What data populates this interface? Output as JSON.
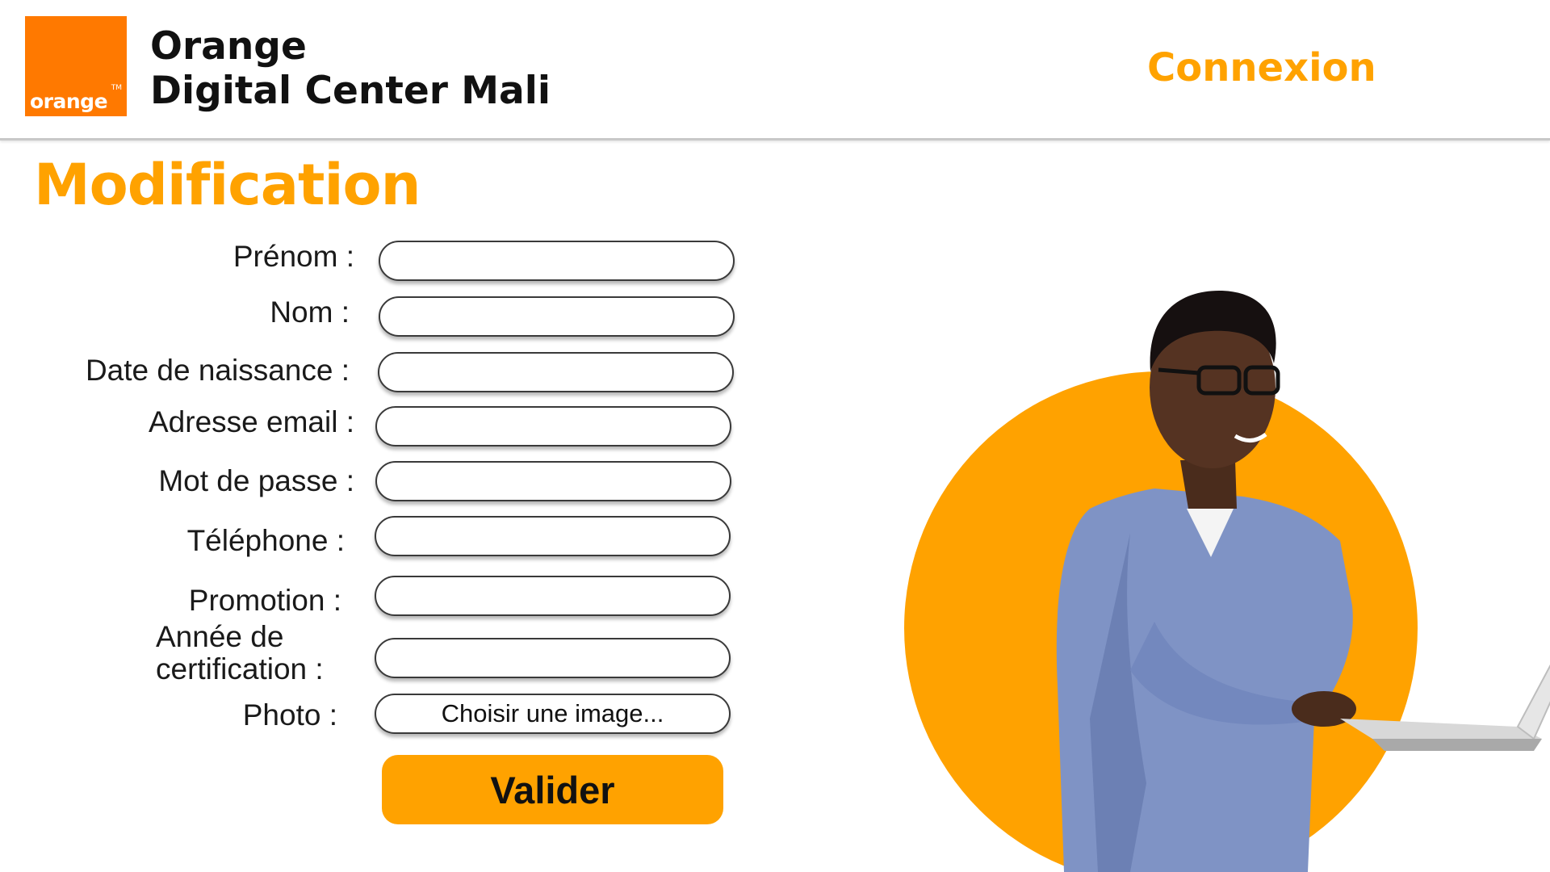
{
  "header": {
    "logo_text": "orange",
    "logo_tm": "TM",
    "brand_line1": "Orange",
    "brand_line2": "Digital Center Mali",
    "login_link": "Connexion"
  },
  "page": {
    "title": "Modification"
  },
  "form": {
    "fields": [
      {
        "label": "Prénom :",
        "value": ""
      },
      {
        "label": "Nom :",
        "value": ""
      },
      {
        "label": "Date de naissance :",
        "value": ""
      },
      {
        "label": "Adresse email :",
        "value": ""
      },
      {
        "label": "Mot de passe :",
        "value": ""
      },
      {
        "label": "Téléphone :",
        "value": ""
      },
      {
        "label": "Promotion :",
        "value": ""
      },
      {
        "label_line1": "Année de",
        "label_line2": "certification :",
        "value": ""
      }
    ],
    "photo_label": "Photo :",
    "photo_button": "Choisir une image...",
    "submit_label": "Valider"
  },
  "colors": {
    "accent": "#ffa200",
    "brand_orange": "#ff7900",
    "text": "#111111"
  },
  "illustration": {
    "icon": "student-with-laptop-illustration"
  }
}
